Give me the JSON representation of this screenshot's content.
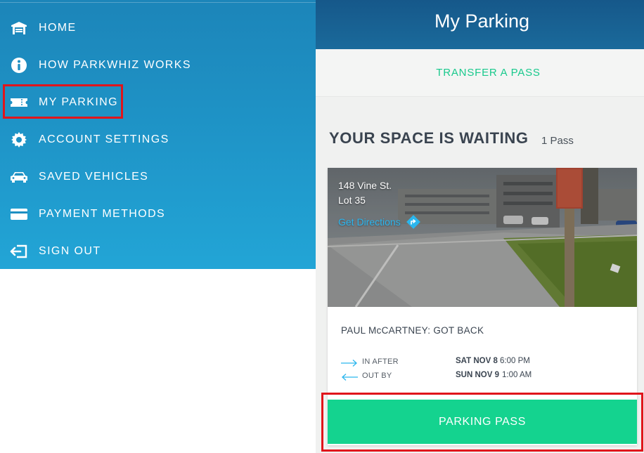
{
  "menu": {
    "items": [
      {
        "label": "HOME",
        "icon": "garage-icon"
      },
      {
        "label": "HOW PARKWHIZ WORKS",
        "icon": "info-icon"
      },
      {
        "label": "MY PARKING",
        "icon": "ticket-icon"
      },
      {
        "label": "ACCOUNT SETTINGS",
        "icon": "gear-icon"
      },
      {
        "label": "SAVED VEHICLES",
        "icon": "car-icon"
      },
      {
        "label": "PAYMENT METHODS",
        "icon": "credit-card-icon"
      },
      {
        "label": "SIGN OUT",
        "icon": "sign-out-icon"
      }
    ],
    "highlighted": "MY PARKING"
  },
  "header": {
    "title": "My Parking"
  },
  "transfer": {
    "label": "TRANSFER A PASS"
  },
  "section": {
    "title": "YOUR SPACE IS WAITING",
    "count": "1 Pass"
  },
  "card": {
    "address_line1": "148 Vine St.",
    "address_line2": "Lot 35",
    "directions_label": "Get Directions",
    "event": "PAUL McCARTNEY: GOT BACK",
    "in_label": "IN AFTER",
    "in_day": "SAT NOV 8",
    "in_time": "6:00 PM",
    "out_label": "OUT BY",
    "out_day": "SUN NOV 9",
    "out_time": "1:00 AM"
  },
  "pass_button": {
    "label": "PARKING PASS"
  },
  "colors": {
    "menu_bg": "#1f96c9",
    "header_bg": "#16588a",
    "accent_green": "#14d38f",
    "link_blue": "#2bb6ee",
    "highlight_red": "#e0151b"
  }
}
